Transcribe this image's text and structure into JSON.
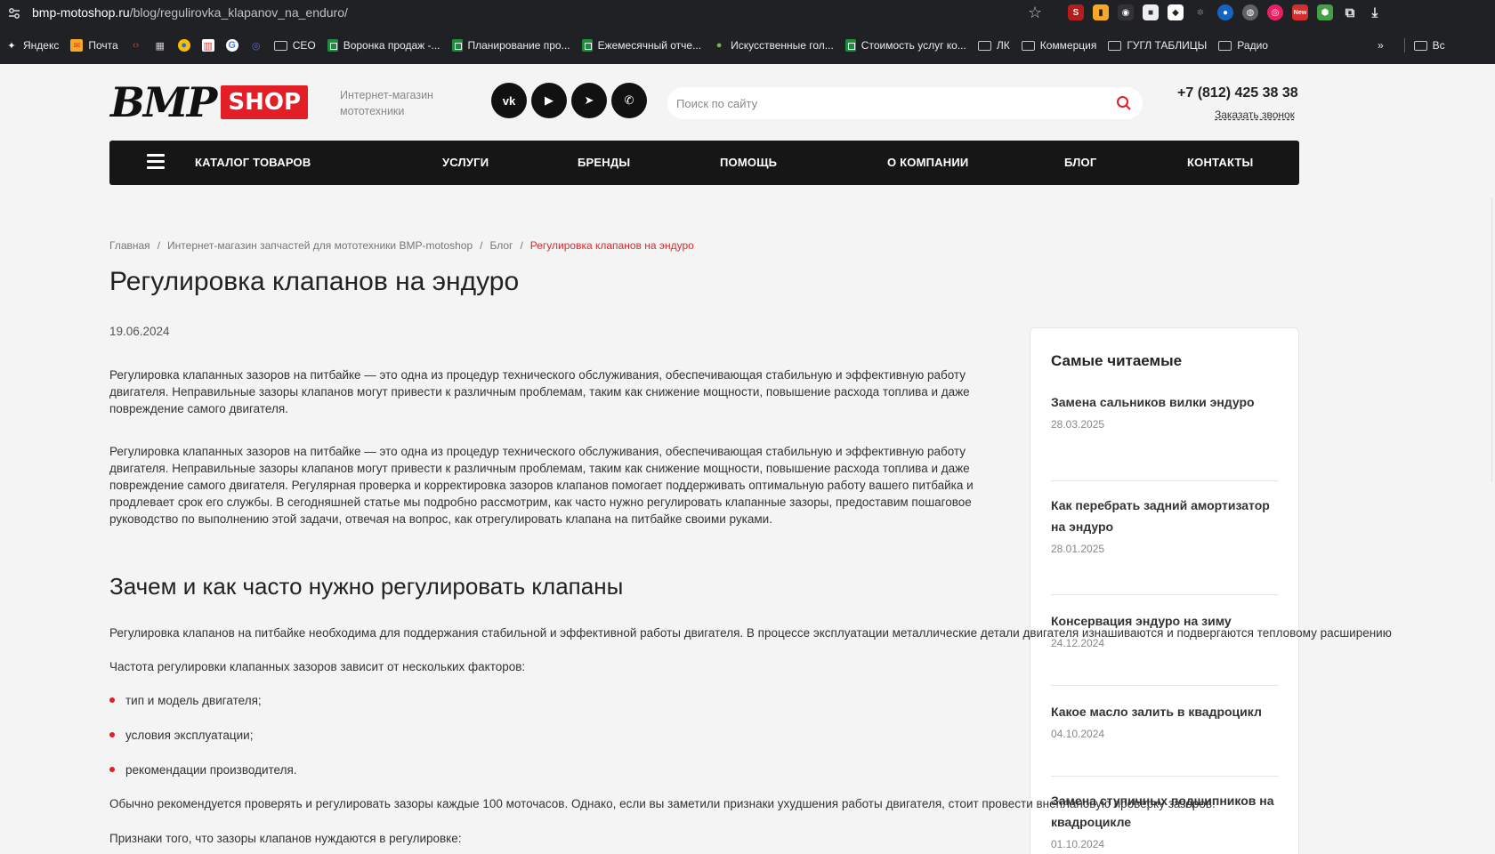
{
  "browser": {
    "url_host": "bmp-motoshop.ru",
    "url_path": "/blog/regulirovka_klapanov_na_enduro/",
    "bookmarks": [
      {
        "label": "Яндекс",
        "icon": "sparkle-icon"
      },
      {
        "label": "Почта",
        "icon": "mail-icon"
      },
      {
        "label": "",
        "icon": "code-icon"
      },
      {
        "label": "",
        "icon": "store-icon"
      },
      {
        "label": "",
        "icon": "browser-icon"
      },
      {
        "label": "",
        "icon": "chart-icon"
      },
      {
        "label": "",
        "icon": "google-icon"
      },
      {
        "label": "",
        "icon": "circle-icon"
      },
      {
        "label": "СЕО",
        "icon": "folder-icon"
      },
      {
        "label": "Воронка продаж -...",
        "icon": "sheet-icon"
      },
      {
        "label": "Планирование про...",
        "icon": "sheet-icon"
      },
      {
        "label": "Ежемесячный отче...",
        "icon": "sheet-icon"
      },
      {
        "label": "Искусственные гол...",
        "icon": "dot-icon"
      },
      {
        "label": "Стоимость услуг ко...",
        "icon": "sheet-icon"
      },
      {
        "label": "ЛК",
        "icon": "folder-icon"
      },
      {
        "label": "Коммерция",
        "icon": "folder-icon"
      },
      {
        "label": "ГУГЛ ТАБЛИЦЫ",
        "icon": "folder-icon"
      },
      {
        "label": "Радио",
        "icon": "folder-icon"
      }
    ],
    "more": "»",
    "last_bookmark": "Вс",
    "ext_new_badge": "New"
  },
  "header": {
    "logo_text": "BMP",
    "logo_shop": "SHOP",
    "tagline": "Интернет-магазин мототехники",
    "socials": [
      "vk",
      "youtube",
      "telegram",
      "whatsapp"
    ],
    "social_labels": {
      "vk": "vk",
      "youtube": "▶",
      "telegram": "➤",
      "whatsapp": "✆"
    },
    "search_placeholder": "Поиск по сайту",
    "phone": "+7 (812) 425 38 38",
    "callback": "Заказать звонок"
  },
  "nav": {
    "catalog": "КАТАЛОГ ТОВАРОВ",
    "services": "УСЛУГИ",
    "brands": "БРЕНДЫ",
    "help": "ПОМОЩЬ",
    "about": "О КОМПАНИИ",
    "blog": "БЛОГ",
    "contacts": "КОНТАКТЫ"
  },
  "breadcrumb": {
    "home": "Главная",
    "shop": "Интернет-магазин запчастей для мототехники BMP-motoshop",
    "blog": "Блог",
    "current": "Регулировка клапанов на эндуро",
    "sep": "/"
  },
  "article": {
    "title": "Регулировка клапанов на эндуро",
    "date": "19.06.2024",
    "p1": "Регулировка клапанных зазоров на питбайке — это одна из процедур технического обслуживания, обеспечивающая стабильную и эффективную работу двигателя. Неправильные зазоры клапанов могут привести к различным проблемам, таким как снижение мощности, повышение расхода топлива и даже повреждение самого двигателя.",
    "p2": "Регулировка клапанных зазоров на питбайке — это одна из процедур технического обслуживания, обеспечивающая стабильную и эффективную работу двигателя. Неправильные зазоры клапанов могут привести к различным проблемам, таким как снижение мощности, повышение расхода топлива и даже повреждение самого двигателя. Регулярная проверка и корректировка зазоров клапанов помогает поддерживать оптимальную работу вашего питбайка и продлевает срок его службы. В сегодняшней статье мы подробно рассмотрим, как часто нужно регулировать клапанные зазоры, предоставим пошаговое руководство по выполнению этой задачи, отвечая на вопрос, как отрегулировать клапана на питбайке своими руками.",
    "h2": "Зачем и как часто нужно регулировать клапаны",
    "line1": "Регулировка клапанов на питбайке необходима для поддержания стабильной и эффективной работы двигателя. В процессе эксплуатации металлические детали двигателя изнашиваются и подвергаются тепловому расширению",
    "line2": "Частота регулировки клапанных зазоров зависит от нескольких факторов:",
    "bullets": [
      "тип и модель двигателя;",
      "условия эксплуатации;",
      "рекомендации производителя."
    ],
    "line3": "Обычно рекомендуется проверять и регулировать зазоры каждые 100 моточасов. Однако, если вы заметили признаки ухудшения работы двигателя, стоит провести внеплановую проверку зазоров.",
    "line4": "Признаки того, что зазоры клапанов нуждаются в регулировке:"
  },
  "sidebar": {
    "title": "Самые читаемые",
    "items": [
      {
        "title": "Замена сальников вилки эндуро",
        "date": "28.03.2025"
      },
      {
        "title": "Как перебрать задний амортизатор на эндуро",
        "date": "28.01.2025"
      },
      {
        "title": "Консервация эндуро на зиму",
        "date": "24.12.2024"
      },
      {
        "title": "Какое масло залить в квадроцикл",
        "date": "04.10.2024"
      },
      {
        "title": "Замена ступичных подшипников на квадроцикле",
        "date": "01.10.2024"
      }
    ]
  }
}
